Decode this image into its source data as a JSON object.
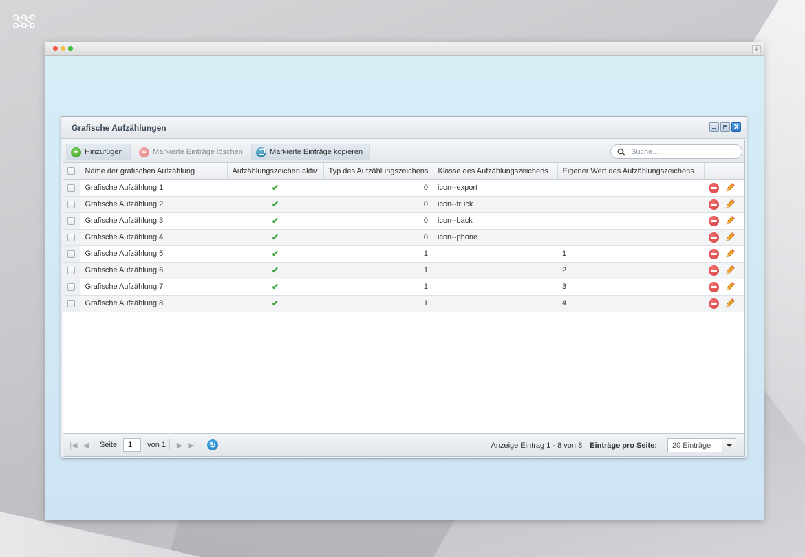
{
  "window": {
    "title": "Grafische Aufzählungen",
    "controls": {
      "close": "X"
    }
  },
  "toolbar": {
    "add_label": "Hinzufügen",
    "delete_label": "Markierte Einträge löschen",
    "copy_label": "Markierte Einträge kopieren",
    "search_placeholder": "Suche..."
  },
  "table": {
    "headers": [
      "Name der grafischen Aufzählung",
      "Aufzählungszeichen aktiv",
      "Typ des Aufzählungszeichens",
      "Klasse des Aufzählungszeichens",
      "Eigener Wert des Aufzählungszeichens"
    ],
    "check_glyph": "✔",
    "rows": [
      {
        "name": "Grafische Aufzählung 1",
        "type": "0",
        "class": "icon--export",
        "value": ""
      },
      {
        "name": "Grafische Aufzählung 2",
        "type": "0",
        "class": "icon--truck",
        "value": ""
      },
      {
        "name": "Grafische Aufzählung 3",
        "type": "0",
        "class": "icon--back",
        "value": ""
      },
      {
        "name": "Grafische Aufzählung 4",
        "type": "0",
        "class": "icon--phone",
        "value": ""
      },
      {
        "name": "Grafische Aufzählung 5",
        "type": "1",
        "class": "",
        "value": "1"
      },
      {
        "name": "Grafische Aufzählung 6",
        "type": "1",
        "class": "",
        "value": "2"
      },
      {
        "name": "Grafische Aufzählung 7",
        "type": "1",
        "class": "",
        "value": "3"
      },
      {
        "name": "Grafische Aufzählung 8",
        "type": "1",
        "class": "",
        "value": "4"
      }
    ]
  },
  "pager": {
    "page_label": "Seite",
    "page_value": "1",
    "of_label": "von 1",
    "display_info": "Anzeige Eintrag 1 - 8 von 8",
    "per_page_label": "Einträge pro Seite:",
    "per_page_value": "20 Einträge"
  },
  "colors": {
    "accent": "#2b78c6",
    "success": "#3aa235",
    "danger": "#d33838"
  }
}
